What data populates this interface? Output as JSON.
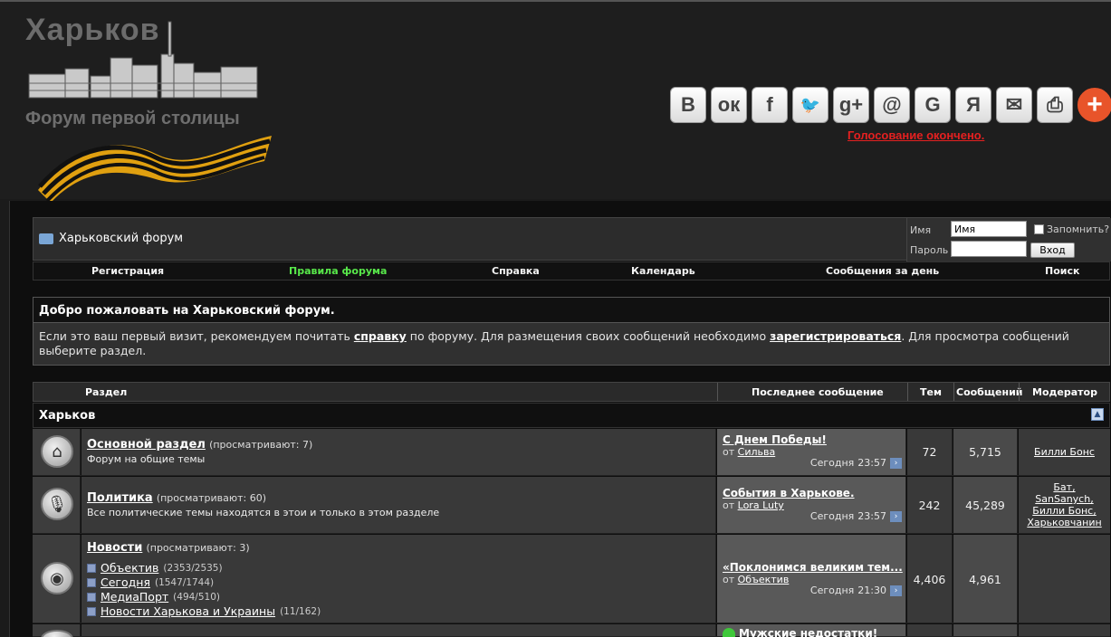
{
  "header": {
    "logo_title": "Харьков",
    "logo_subtitle": "Форум первой столицы",
    "share_buttons": [
      {
        "label": "B",
        "icon": "vkontakte-icon"
      },
      {
        "label": "ок",
        "icon": "odnoklassniki-icon"
      },
      {
        "label": "f",
        "icon": "facebook-icon"
      },
      {
        "label": "🐦",
        "icon": "twitter-icon"
      },
      {
        "label": "g+",
        "icon": "google-plus-icon"
      },
      {
        "label": "@",
        "icon": "mail-ru-icon"
      },
      {
        "label": "G",
        "icon": "google-bookmark-icon"
      },
      {
        "label": "Я",
        "icon": "yandex-icon"
      },
      {
        "label": "✉",
        "icon": "email-icon"
      },
      {
        "label": "⎙",
        "icon": "print-icon"
      },
      {
        "label": "+",
        "icon": "more-share-icon"
      }
    ],
    "poll_link": "Голосование окончено."
  },
  "navbar": {
    "forum_name": "Харьковский форум",
    "login": {
      "name_label": "Имя",
      "name_value": "Имя",
      "password_label": "Пароль",
      "remember_label": "Запомнить?",
      "login_button": "Вход"
    },
    "menu": [
      {
        "label": "Регистрация"
      },
      {
        "label": "Правила форума",
        "color": "#58e84a"
      },
      {
        "label": "Справка"
      },
      {
        "label": "Календарь"
      },
      {
        "label": "Сообщения за день"
      },
      {
        "label": "Поиск"
      }
    ]
  },
  "welcome": {
    "title": "Добро пожаловать на Харьковский форум.",
    "text_1": "Если это ваш первый визит, рекомендуем почитать ",
    "link_help": "справку",
    "text_2": " по форуму. Для размещения своих сообщений необходимо ",
    "link_register": "зарегистрироваться",
    "text_3": ". Для просмотра сообщений выберите раздел."
  },
  "table": {
    "headers": {
      "section": "Раздел",
      "last_post": "Последнее сообщение",
      "threads": "Тем",
      "posts": "Сообщений",
      "moderator": "Модератор"
    },
    "category": "Харьков",
    "forums": [
      {
        "icon": "home-icon",
        "title": "Основной раздел",
        "views": "(просматривают: 7)",
        "desc": "Форум на общие темы",
        "last_title": "С Днем Победы!",
        "last_by_prefix": "от",
        "last_by": "Сильва",
        "last_date": "Сегодня",
        "last_time": "23:57",
        "threads": "72",
        "posts": "5,715",
        "mods": [
          "Билли Бонс"
        ]
      },
      {
        "icon": "microphone-icon",
        "title": "Политика",
        "views": "(просматривают: 60)",
        "desc": "Все политические темы находятся в этои и только в этом разделе",
        "last_title": "События в Харькове.",
        "last_by_prefix": "от",
        "last_by": "Lora Luty",
        "last_date": "Сегодня",
        "last_time": "23:57",
        "threads": "242",
        "posts": "45,289",
        "mods": [
          "Бат,",
          "SanSanych,",
          "Билли Бонс,",
          "Харьковчанин"
        ]
      },
      {
        "icon": "news-icon",
        "title": "Новости",
        "views": "(просматривают: 3)",
        "subforums": [
          {
            "name": "Объектив",
            "count": "(2353/2535)"
          },
          {
            "name": "Сегодня",
            "count": "(1547/1744)"
          },
          {
            "name": "МедиаПорт",
            "count": "(494/510)"
          },
          {
            "name": "Новости Харькова и Украины",
            "count": "(11/162)"
          }
        ],
        "last_title": "«Поклонимся великим тем...",
        "last_by_prefix": "от",
        "last_by": "Объектив",
        "last_date": "Сегодня",
        "last_time": "21:30",
        "threads": "4,406",
        "posts": "4,961",
        "mods": []
      },
      {
        "icon": "forum-icon",
        "last_title": "Мужские недостатки!"
      }
    ]
  }
}
